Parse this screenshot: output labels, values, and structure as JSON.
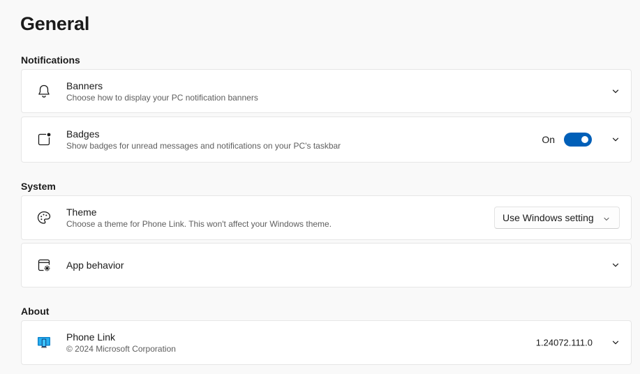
{
  "page": {
    "title": "General"
  },
  "sections": {
    "notifications": "Notifications",
    "system": "System",
    "about": "About"
  },
  "banners": {
    "title": "Banners",
    "description": "Choose how to display your PC notification banners",
    "icon": "bell-icon"
  },
  "badges": {
    "title": "Badges",
    "description": "Show badges for unread messages and notifications on your PC's taskbar",
    "toggle_label": "On",
    "toggle_on": true,
    "icon": "badge-icon"
  },
  "theme": {
    "title": "Theme",
    "description": "Choose a theme for Phone Link. This won't affect your Windows theme.",
    "selected": "Use Windows setting",
    "icon": "palette-icon"
  },
  "app_behavior": {
    "title": "App behavior",
    "icon": "app-settings-icon"
  },
  "about": {
    "title": "Phone Link",
    "description": "© 2024 Microsoft Corporation",
    "version": "1.24072.111.0",
    "icon": "phone-link-icon"
  },
  "colors": {
    "accent": "#005fb8",
    "background": "#f9f9f9",
    "card": "#ffffff"
  }
}
